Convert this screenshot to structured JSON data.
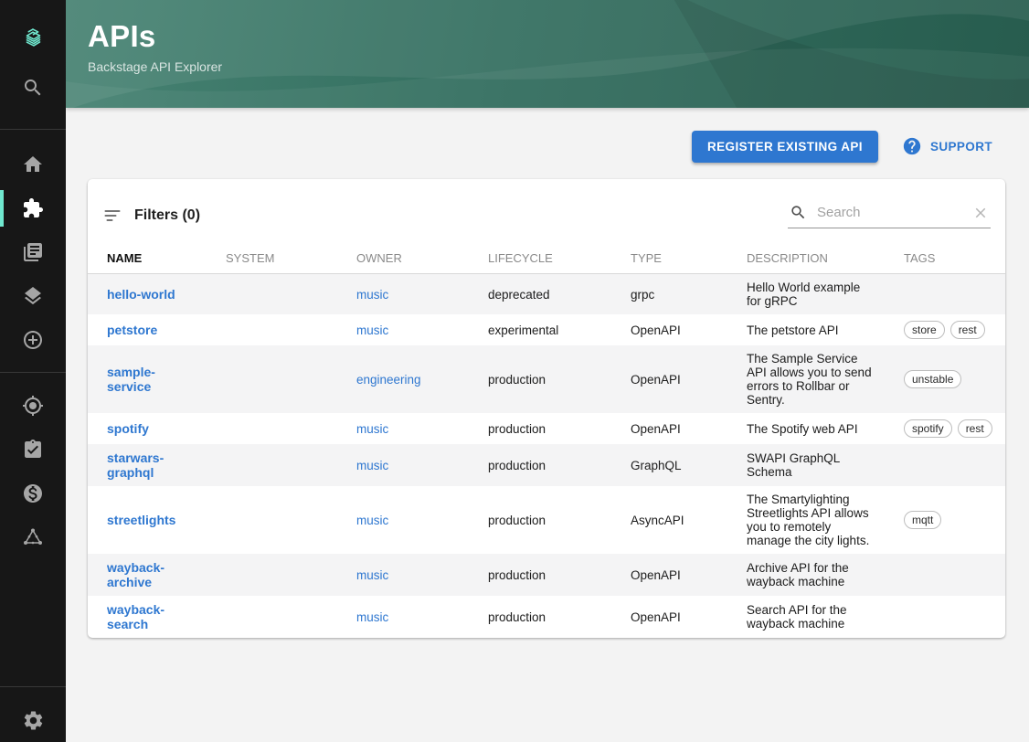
{
  "header": {
    "title": "APIs",
    "subtitle": "Backstage API Explorer"
  },
  "toolbar": {
    "register_button": "REGISTER EXISTING API",
    "support_label": "SUPPORT"
  },
  "panel": {
    "filters_label": "Filters (0)",
    "search_placeholder": "Search"
  },
  "table": {
    "columns": [
      "NAME",
      "SYSTEM",
      "OWNER",
      "LIFECYCLE",
      "TYPE",
      "DESCRIPTION",
      "TAGS"
    ],
    "rows": [
      {
        "name": "hello-world",
        "system": "",
        "owner": "music",
        "lifecycle": "deprecated",
        "type": "grpc",
        "description": "Hello World example for gRPC",
        "tags": []
      },
      {
        "name": "petstore",
        "system": "",
        "owner": "music",
        "lifecycle": "experimental",
        "type": "OpenAPI",
        "description": "The petstore API",
        "tags": [
          "store",
          "rest"
        ]
      },
      {
        "name": "sample-service",
        "system": "",
        "owner": "engineering",
        "lifecycle": "production",
        "type": "OpenAPI",
        "description": "The Sample Service API allows you to send errors to Rollbar or Sentry.",
        "tags": [
          "unstable"
        ]
      },
      {
        "name": "spotify",
        "system": "",
        "owner": "music",
        "lifecycle": "production",
        "type": "OpenAPI",
        "description": "The Spotify web API",
        "tags": [
          "spotify",
          "rest"
        ]
      },
      {
        "name": "starwars-graphql",
        "system": "",
        "owner": "music",
        "lifecycle": "production",
        "type": "GraphQL",
        "description": "SWAPI GraphQL Schema",
        "tags": []
      },
      {
        "name": "streetlights",
        "system": "",
        "owner": "music",
        "lifecycle": "production",
        "type": "AsyncAPI",
        "description": "The Smartylighting Streetlights API allows you to remotely manage the city lights.",
        "tags": [
          "mqtt"
        ]
      },
      {
        "name": "wayback-archive",
        "system": "",
        "owner": "music",
        "lifecycle": "production",
        "type": "OpenAPI",
        "description": "Archive API for the wayback machine",
        "tags": []
      },
      {
        "name": "wayback-search",
        "system": "",
        "owner": "music",
        "lifecycle": "production",
        "type": "OpenAPI",
        "description": "Search API for the wayback machine",
        "tags": []
      }
    ]
  },
  "sidebar": {
    "icons": [
      "backstage-logo",
      "search",
      "home",
      "extension-puzzle",
      "library-docs",
      "layers",
      "add-circle",
      "my-location",
      "assignment-check",
      "monetization",
      "graphql",
      "settings-gear"
    ],
    "active": "extension-puzzle"
  },
  "colors": {
    "accent_teal": "#70e8cf",
    "primary_blue": "#2e77d0",
    "header_green": "#336e5f",
    "sidebar_bg": "#171717",
    "page_bg": "#f3f3f3",
    "stripe_bg": "#f4f4f5"
  }
}
